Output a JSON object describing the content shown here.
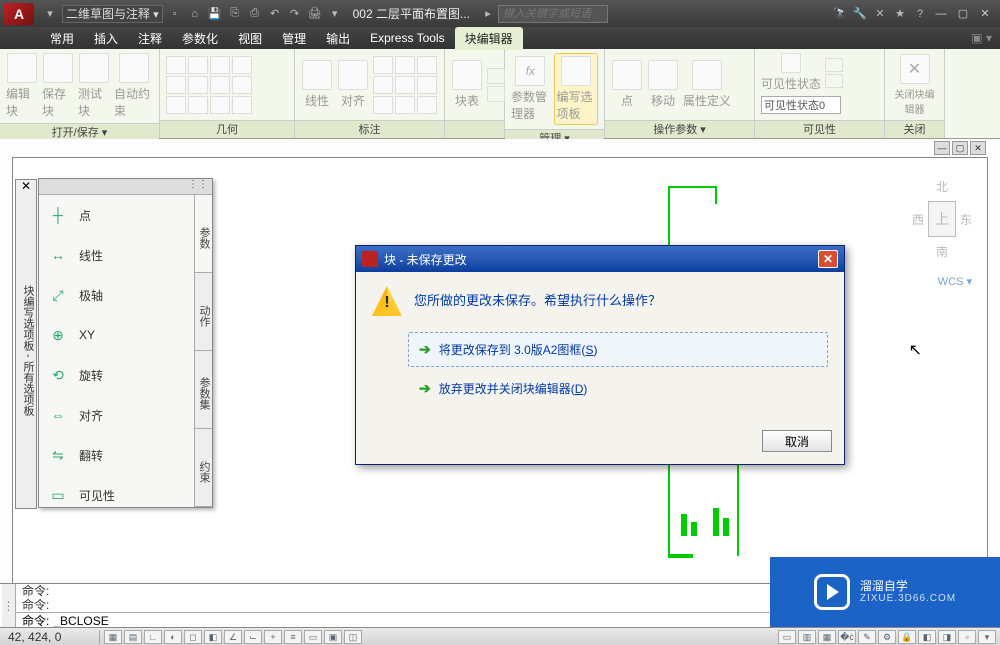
{
  "titlebar": {
    "logo_text": "A",
    "workspace": "二维草图与注释",
    "doc_title": "002 二层平面布置图...",
    "search_placeholder": "键入关键字或短语"
  },
  "menubar": {
    "items": [
      "常用",
      "插入",
      "注释",
      "参数化",
      "视图",
      "管理",
      "输出",
      "Express Tools",
      "块编辑器"
    ],
    "active_index": 8
  },
  "ribbon": {
    "panels": [
      {
        "label": "打开/保存 ▾",
        "tools": [
          "编辑块",
          "保存块",
          "测试块",
          "自动约束"
        ]
      },
      {
        "label": "几何",
        "tools": []
      },
      {
        "label": "标注",
        "tools": [
          "线性",
          "对齐"
        ]
      },
      {
        "label": "",
        "tools": [
          "块表"
        ]
      },
      {
        "label": "管理 ▾",
        "tools": [
          "参数管理器",
          "编写选项板"
        ],
        "active_tool": 1
      },
      {
        "label": "操作参数 ▾",
        "tools": [
          "点",
          "移动",
          "属性定义"
        ]
      },
      {
        "label": "可见性",
        "tools": [
          "可见性状态"
        ],
        "combo": "可见性状态0"
      },
      {
        "label": "关闭",
        "tools": [
          "关闭块编辑器"
        ]
      }
    ]
  },
  "palette": {
    "title": "块编写选项板 - 所有选项板",
    "side_tabs": [
      "参数",
      "动作",
      "参数集",
      "约束"
    ],
    "active_tab": 0,
    "items": [
      {
        "icon": "┼",
        "label": "点"
      },
      {
        "icon": "↔",
        "label": "线性"
      },
      {
        "icon": "⤢",
        "label": "极轴"
      },
      {
        "icon": "⊕",
        "label": "XY"
      },
      {
        "icon": "⟲",
        "label": "旋转"
      },
      {
        "icon": "⇔",
        "label": "对齐"
      },
      {
        "icon": "⇋",
        "label": "翻转"
      },
      {
        "icon": "▭",
        "label": "可见性"
      }
    ]
  },
  "navcube": {
    "n": "北",
    "s": "南",
    "e": "东",
    "w": "西",
    "face": "上"
  },
  "wcs_label": "WCS ▾",
  "dialog": {
    "title": "块 - 未保存更改",
    "message": "您所做的更改未保存。希望执行什么操作？",
    "option1_prefix": "将更改保存到 3.0版A2图框(",
    "option1_key": "S",
    "option1_suffix": ")",
    "option2_prefix": "放弃更改并关闭块编辑器(",
    "option2_key": "D",
    "option2_suffix": ")",
    "cancel": "取消"
  },
  "command": {
    "history_line1": "命令:",
    "history_line2": "命令:",
    "prompt_label": "命令:",
    "current": "_BCLOSE"
  },
  "status": {
    "coords": "42, 424, 0"
  },
  "watermark": {
    "main": "溜溜自学",
    "sub": "ZIXUE.3D66.COM"
  }
}
